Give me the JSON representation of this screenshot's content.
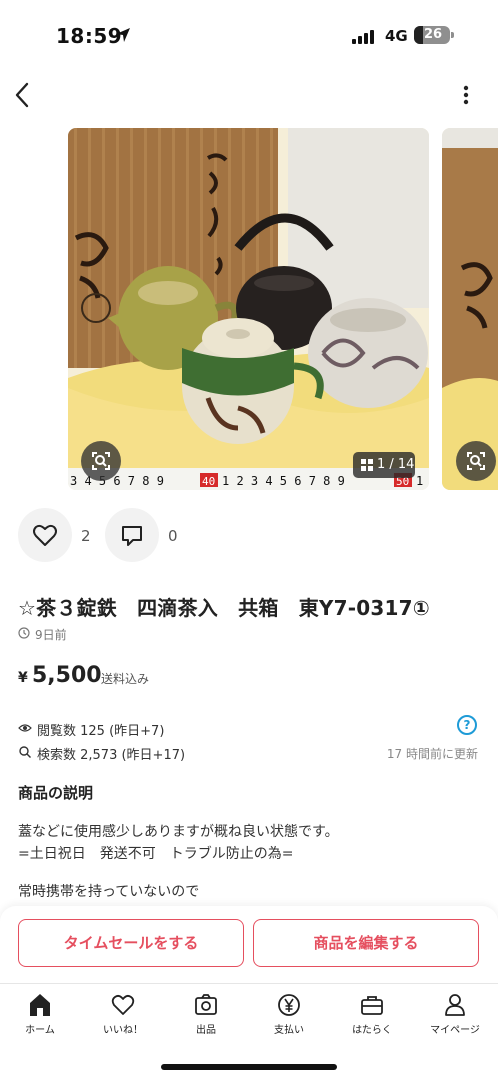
{
  "status_bar": {
    "time": "18:59",
    "network": "4G",
    "battery": "26"
  },
  "gallery": {
    "counter": "1 / 14",
    "current": 1,
    "total": 14
  },
  "actions": {
    "likes": "2",
    "comments": "0"
  },
  "item": {
    "title": "☆茶３錠鉄　四滴茶入　共箱　東Y7-0317①",
    "posted": "9日前",
    "price_symbol": "¥",
    "price": "5,500",
    "shipping": "送料込み"
  },
  "stats": {
    "views": "閲覧数  125 (昨日+7)",
    "searches": "検索数  2,573 (昨日+17)",
    "updated": "17 時間前に更新",
    "help": "?"
  },
  "description": {
    "heading": "商品の説明",
    "lines": [
      "蓋などに使用感少しありますが概ね良い状態です。",
      "=土日祝日　発送不可　トラブル防止の為=",
      "常時携帯を持っていないので"
    ]
  },
  "cta": {
    "timesale": "タイムセールをする",
    "edit": "商品を編集する"
  },
  "tabbar": [
    {
      "label": "ホーム",
      "icon": "home-icon"
    },
    {
      "label": "いいね！",
      "icon": "heart-icon"
    },
    {
      "label": "出品",
      "icon": "camera-icon"
    },
    {
      "label": "支払い",
      "icon": "yen-icon"
    },
    {
      "label": "はたらく",
      "icon": "briefcase-icon"
    },
    {
      "label": "マイページ",
      "icon": "person-icon"
    }
  ],
  "colors": {
    "accent": "#e54f5f",
    "help": "#1e9bd7",
    "background": "#ffffff"
  }
}
